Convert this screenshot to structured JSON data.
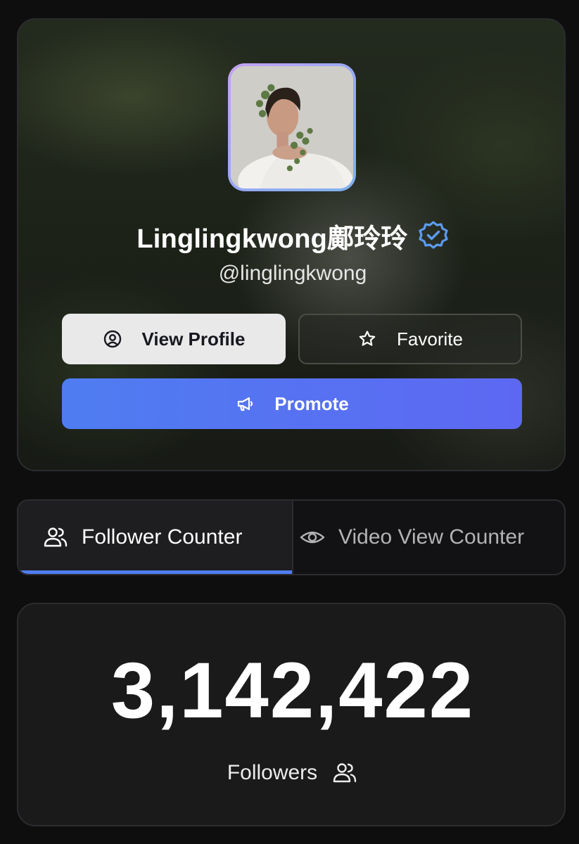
{
  "profile": {
    "display_name": "Linglingkwong鄺玲玲",
    "handle": "@linglingkwong",
    "verified_icon": "verified-badge-icon",
    "avatar_alt": "profile photo"
  },
  "actions": {
    "view_profile_label": "View Profile",
    "view_profile_icon": "user-circle-icon",
    "favorite_label": "Favorite",
    "favorite_icon": "star-icon",
    "promote_label": "Promote",
    "promote_icon": "megaphone-icon"
  },
  "tabs": [
    {
      "label": "Follower Counter",
      "icon": "users-icon",
      "active": true
    },
    {
      "label": "Video View Counter",
      "icon": "eye-icon",
      "active": false
    }
  ],
  "counter": {
    "value": "3,142,422",
    "label": "Followers",
    "icon": "users-icon"
  },
  "colors": {
    "accent": "#4f7df1",
    "promote_gradient_end": "#5d68f2",
    "verified": "#5b9cf0",
    "background": "#0e0e0f"
  }
}
